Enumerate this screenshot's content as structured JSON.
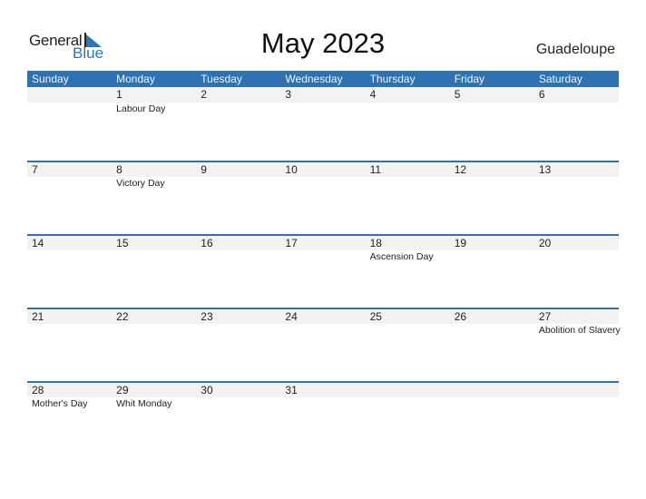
{
  "logo": {
    "word1": "General",
    "word2": "Blue"
  },
  "title": "May 2023",
  "region": "Guadeloupe",
  "colors": {
    "accent": "#2e72b4",
    "date_row_bg": "#f2f2f2",
    "logo_blue": "#2a75bb"
  },
  "weekdays": [
    "Sunday",
    "Monday",
    "Tuesday",
    "Wednesday",
    "Thursday",
    "Friday",
    "Saturday"
  ],
  "weeks": [
    {
      "days": [
        "",
        "1",
        "2",
        "3",
        "4",
        "5",
        "6"
      ],
      "holidays": [
        "",
        "Labour Day",
        "",
        "",
        "",
        "",
        ""
      ]
    },
    {
      "days": [
        "7",
        "8",
        "9",
        "10",
        "11",
        "12",
        "13"
      ],
      "holidays": [
        "",
        "Victory Day",
        "",
        "",
        "",
        "",
        ""
      ]
    },
    {
      "days": [
        "14",
        "15",
        "16",
        "17",
        "18",
        "19",
        "20"
      ],
      "holidays": [
        "",
        "",
        "",
        "",
        "Ascension Day",
        "",
        ""
      ]
    },
    {
      "days": [
        "21",
        "22",
        "23",
        "24",
        "25",
        "26",
        "27"
      ],
      "holidays": [
        "",
        "",
        "",
        "",
        "",
        "",
        "Abolition of Slavery"
      ]
    },
    {
      "days": [
        "28",
        "29",
        "30",
        "31",
        "",
        "",
        ""
      ],
      "holidays": [
        "Mother's Day",
        "Whit Monday",
        "",
        "",
        "",
        "",
        ""
      ]
    }
  ]
}
